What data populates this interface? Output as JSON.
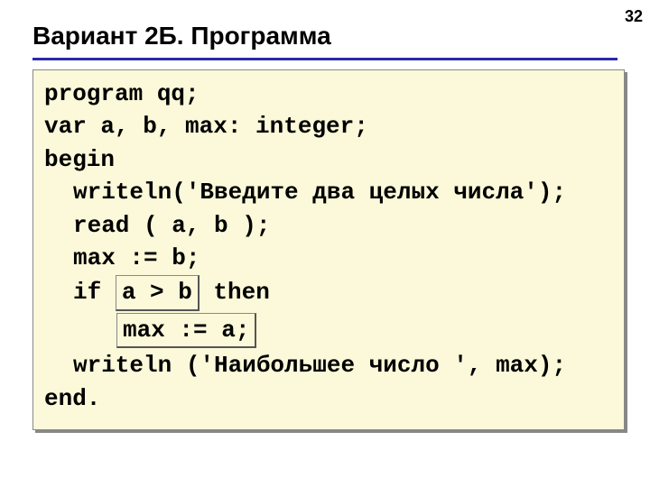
{
  "page_number": "32",
  "title": "Вариант 2Б. Программа",
  "code": {
    "l1": "program qq;",
    "l2": "var a, b, max: integer;",
    "l3": "begin",
    "l4": "writeln('Введите два целых числа');",
    "l5": "read ( a, b );",
    "l6": "max := b;",
    "l7_pre": "if ",
    "l7_hl": "a > b",
    "l7_post": " then",
    "l8_hl": "max := a;",
    "l9": "writeln ('Наибольшее число ', max);",
    "l10": "end."
  }
}
